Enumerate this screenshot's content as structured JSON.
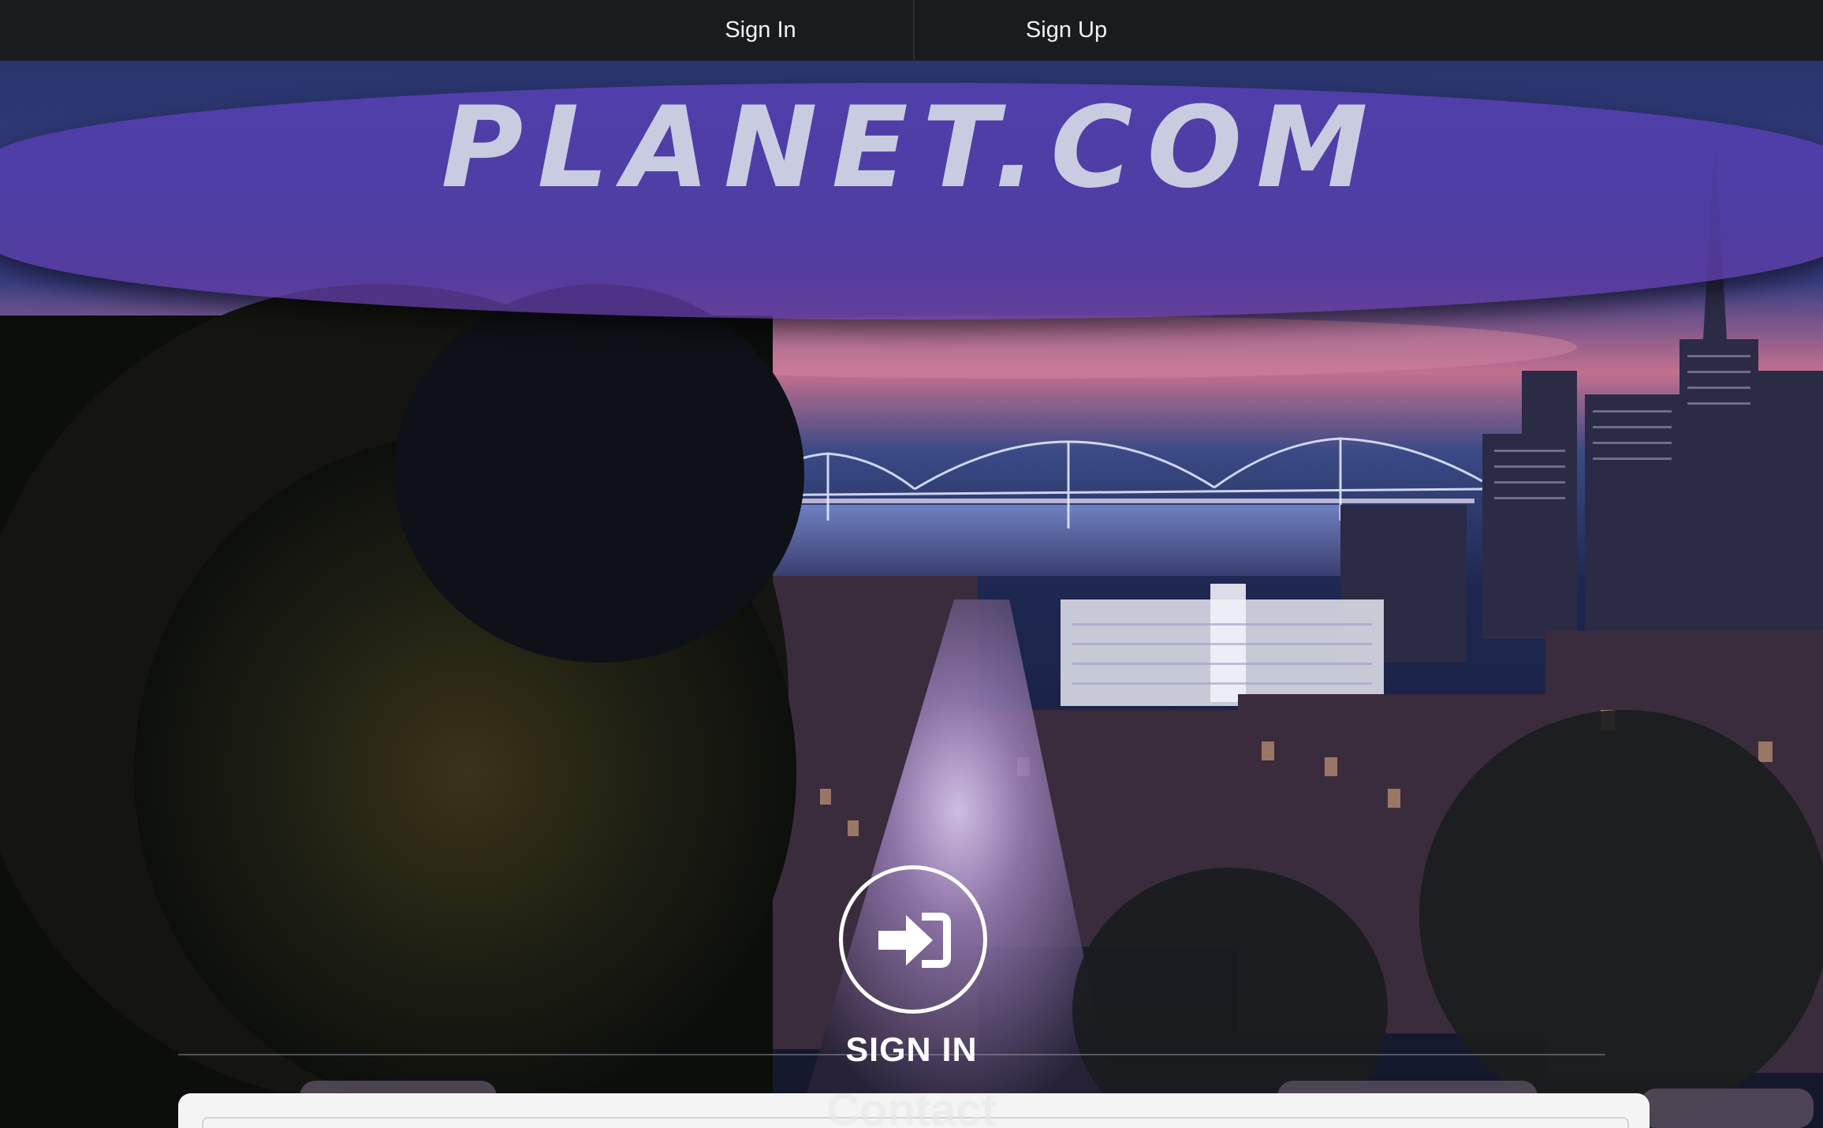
{
  "nav": {
    "signin_label": "Sign In",
    "signup_label": "Sign Up"
  },
  "banner": {
    "title": "PLANET.COM"
  },
  "hero": {
    "signin_label": "SIGN IN",
    "signin_icon": "sign-in-arrow-icon"
  },
  "contact": {
    "title": "Contact"
  },
  "colors": {
    "nav_bg": "#1a1b1f",
    "banner": "#5440b0",
    "title_text": "#c9cce0",
    "card_bg": "#f4f4f4"
  }
}
